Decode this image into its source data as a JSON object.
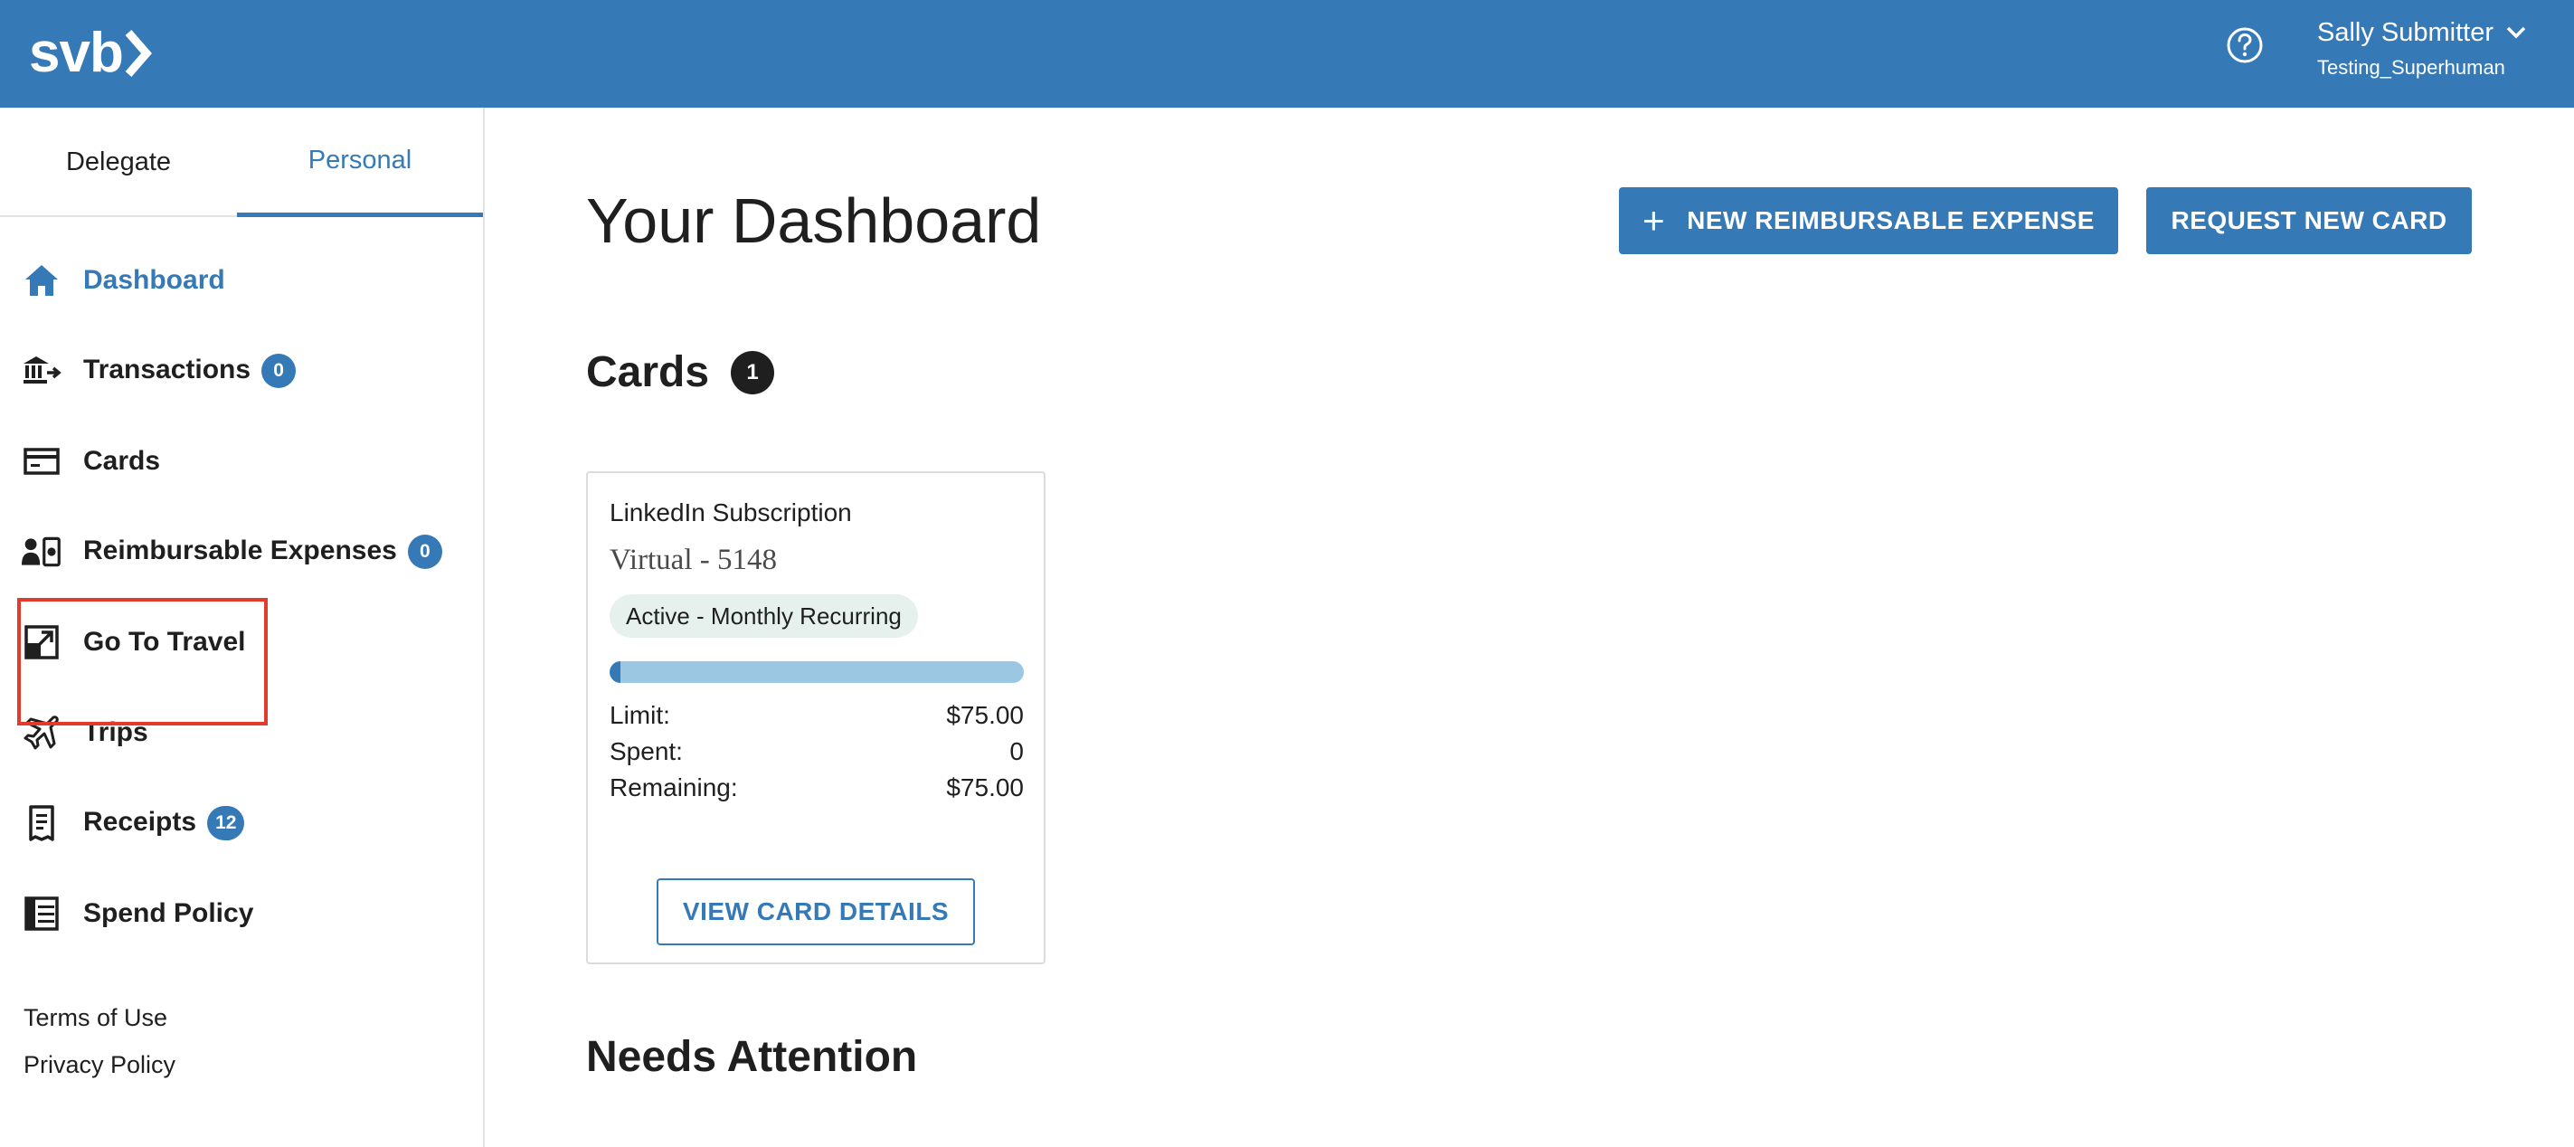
{
  "header": {
    "logo_text": "svb",
    "help_icon": "question-circle-icon",
    "user_name": "Sally Submitter",
    "user_org": "Testing_Superhuman",
    "brand_color": "#3679b7"
  },
  "sidebar": {
    "tabs": [
      {
        "label": "Delegate",
        "active": false
      },
      {
        "label": "Personal",
        "active": true
      }
    ],
    "items": [
      {
        "label": "Dashboard",
        "icon": "home-icon",
        "active": true
      },
      {
        "label": "Transactions",
        "icon": "bank-transfer-icon",
        "badge": "0"
      },
      {
        "label": "Cards",
        "icon": "card-icon"
      },
      {
        "label": "Reimbursable Expenses",
        "icon": "user-receipt-icon",
        "badge": "0"
      },
      {
        "label": "Go To Travel",
        "icon": "external-link-icon",
        "highlighted": true
      },
      {
        "label": "Trips",
        "icon": "airplane-icon"
      },
      {
        "label": "Receipts",
        "icon": "receipt-icon",
        "badge": "12"
      },
      {
        "label": "Spend Policy",
        "icon": "policy-list-icon"
      }
    ],
    "footer_links": [
      "Terms of Use",
      "Privacy Policy"
    ]
  },
  "main": {
    "title": "Your Dashboard",
    "new_expense_button": "NEW REIMBURSABLE EXPENSE",
    "new_expense_icon": "plus-icon",
    "request_card_button": "REQUEST NEW CARD",
    "cards_section": {
      "title": "Cards",
      "count": "1",
      "cards": [
        {
          "name": "LinkedIn Subscription",
          "type": "Virtual - 5148",
          "status": "Active - Monthly Recurring",
          "spent_fraction": 0.0,
          "limit_label": "Limit:",
          "limit_value": "$75.00",
          "spent_label": "Spent:",
          "spent_value": "0",
          "remaining_label": "Remaining:",
          "remaining_value": "$75.00",
          "details_button": "VIEW CARD DETAILS"
        }
      ]
    },
    "needs_attention_title": "Needs Attention"
  }
}
